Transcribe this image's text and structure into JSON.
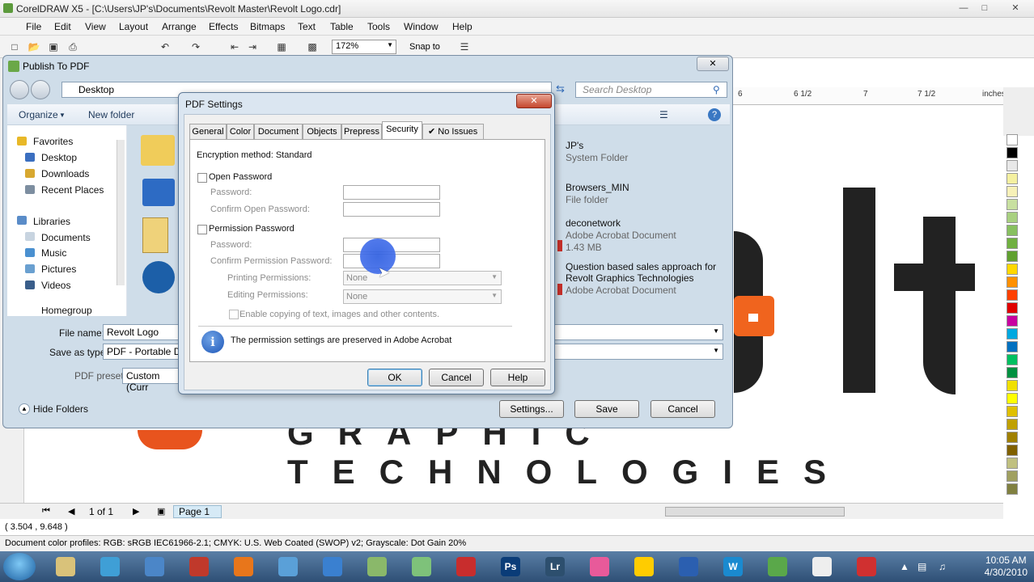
{
  "app": {
    "title": "CorelDRAW X5 - [C:\\Users\\JP's\\Documents\\Revolt Master\\Revolt Logo.cdr]",
    "menu": [
      "File",
      "Edit",
      "View",
      "Layout",
      "Arrange",
      "Effects",
      "Bitmaps",
      "Text",
      "Table",
      "Tools",
      "Window",
      "Help"
    ],
    "zoom": "172%",
    "snap_to": "Snap to",
    "ruler_labels": [
      "6",
      "6 1/2",
      "7",
      "7 1/2",
      "inches"
    ],
    "tagline": "GRAPHIC TECHNOLOGIES",
    "page_count": "1 of 1",
    "page_tab": "Page 1",
    "coords": "( 3.504 , 9.648 )",
    "status": "Document color profiles: RGB: sRGB IEC61966-2.1; CMYK: U.S. Web Coated (SWOP) v2; Grayscale: Dot Gain 20%",
    "palette": [
      "#ffffff",
      "#000000",
      "#e8e8e8",
      "#f4f0a0",
      "#f7f1b8",
      "#c8e0a0",
      "#a8d080",
      "#88c060",
      "#70b040",
      "#60a030",
      "#ffd800",
      "#ff9000",
      "#ff4000",
      "#e00000",
      "#c800a0",
      "#00a8e0",
      "#0070c0",
      "#00c060",
      "#009040",
      "#f0e000",
      "#ffff00",
      "#e0c000",
      "#c0a000",
      "#a08000",
      "#806000",
      "#c0c080",
      "#a0a060",
      "#808040"
    ]
  },
  "publish_dialog": {
    "title": "Publish To PDF",
    "address": "Desktop",
    "search_placeholder": "Search Desktop",
    "organize": "Organize",
    "new_folder": "New folder",
    "nav": {
      "favorites": "Favorites",
      "items1": [
        "Desktop",
        "Downloads",
        "Recent Places"
      ],
      "libraries": "Libraries",
      "items2": [
        "Documents",
        "Music",
        "Pictures",
        "Videos"
      ],
      "homegroup": "Homegroup"
    },
    "files": [
      {
        "name": "JP's",
        "meta": "System Folder"
      },
      {
        "name": "Browsers_MIN",
        "meta": "File folder"
      },
      {
        "name": "deconetwork",
        "meta": "Adobe Acrobat Document",
        "size": "1.43 MB"
      },
      {
        "name": "Question based sales approach for",
        "name2": "Revolt Graphics Technologies",
        "meta": "Adobe Acrobat Document"
      }
    ],
    "file_name_label": "File name:",
    "file_name_value": "Revolt Logo",
    "save_type_label": "Save as type:",
    "save_type_value": "PDF - Portable Doc",
    "preset_label": "PDF preset:",
    "preset_value": "Custom (Curr",
    "hide_folders": "Hide Folders",
    "settings_btn": "Settings...",
    "save_btn": "Save",
    "cancel_btn": "Cancel"
  },
  "pdf_settings": {
    "title": "PDF Settings",
    "tabs": [
      "General",
      "Color",
      "Document",
      "Objects",
      "Prepress",
      "Security",
      "No Issues"
    ],
    "active_tab": "Security",
    "encryption": "Encryption method:  Standard",
    "open_password": "Open Password",
    "password": "Password:",
    "confirm_open": "Confirm Open Password:",
    "permission_password": "Permission Password",
    "confirm_permission": "Confirm Permission Password:",
    "printing_permissions": "Printing Permissions:",
    "printing_value": "None",
    "editing_permissions": "Editing Permissions:",
    "editing_value": "None",
    "enable_copying": "Enable copying of text, images and other contents.",
    "info": "The permission settings are preserved in Adobe Acrobat",
    "ok": "OK",
    "cancel": "Cancel",
    "help": "Help"
  },
  "taskbar": {
    "time": "10:05 AM",
    "date": "4/30/2010",
    "app_colors": [
      "#d9c27a",
      "#3f9fd6",
      "#4b86c8",
      "#c0392b",
      "#e8761b",
      "#5aa0d8",
      "#3a80d0",
      "#8ab86a",
      "#7ec27a",
      "#c82d2d",
      "#0a3c78",
      "#2d4f6e",
      "#e85a9a",
      "#ffcc00",
      "#2b5fb0",
      "#1a8ad0",
      "#5aa84a",
      "#eeeeee",
      "#d03030"
    ],
    "app_labels": [
      "Ps",
      "Lr",
      "W"
    ]
  }
}
